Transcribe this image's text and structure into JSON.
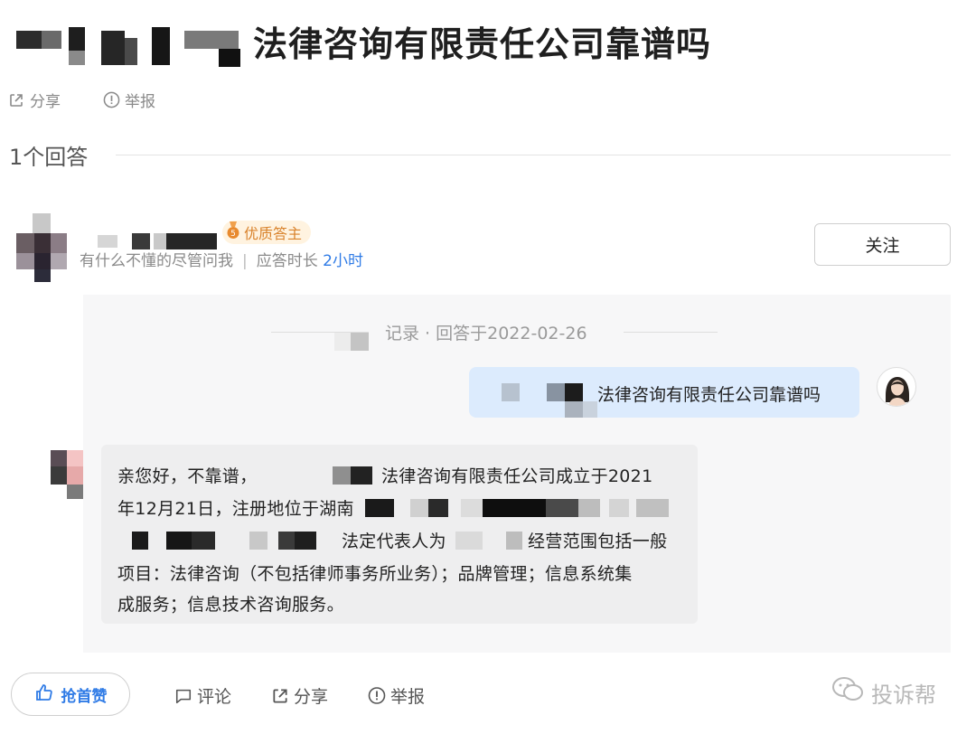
{
  "question": {
    "title_visible": "法律咨询有限责任公司靠谱吗"
  },
  "top_actions": {
    "share": "分享",
    "report": "举报"
  },
  "answers_count_label": "1个回答",
  "answerer": {
    "badge": "优质答主",
    "intro": "有什么不懂的尽管问我",
    "response_label": "应答时长",
    "response_value": "2小时",
    "follow": "关注"
  },
  "record": {
    "text": "记录 · 回答于2022-02-26"
  },
  "chat": {
    "question_visible": "法律咨询有限责任公司靠谱吗",
    "answer": {
      "line1_a": "亲您好，不靠谱，",
      "line1_b": "法律咨询有限责任公司成立于2021",
      "line2": "年12月21日，注册地位于湖南",
      "line3_a": "法定代表人为",
      "line3_b": "经营范围包括一般",
      "line4": "项目：法律咨询（不包括律师事务所业务）；品牌管理；信息系统集",
      "line5": "成服务；信息技术咨询服务。"
    }
  },
  "bottom": {
    "like": "抢首赞",
    "comment": "评论",
    "share": "分享",
    "report": "举报"
  },
  "watermark": "投诉帮",
  "colors": {
    "accent": "#2f7be6",
    "badge": "#d9822b",
    "question_bubble": "#dcebfd",
    "answer_bubble": "#eeeeef"
  },
  "icons": [
    "share-icon",
    "report-icon",
    "medal-icon",
    "thumbs-up-icon",
    "comment-icon",
    "wechat-icon"
  ]
}
